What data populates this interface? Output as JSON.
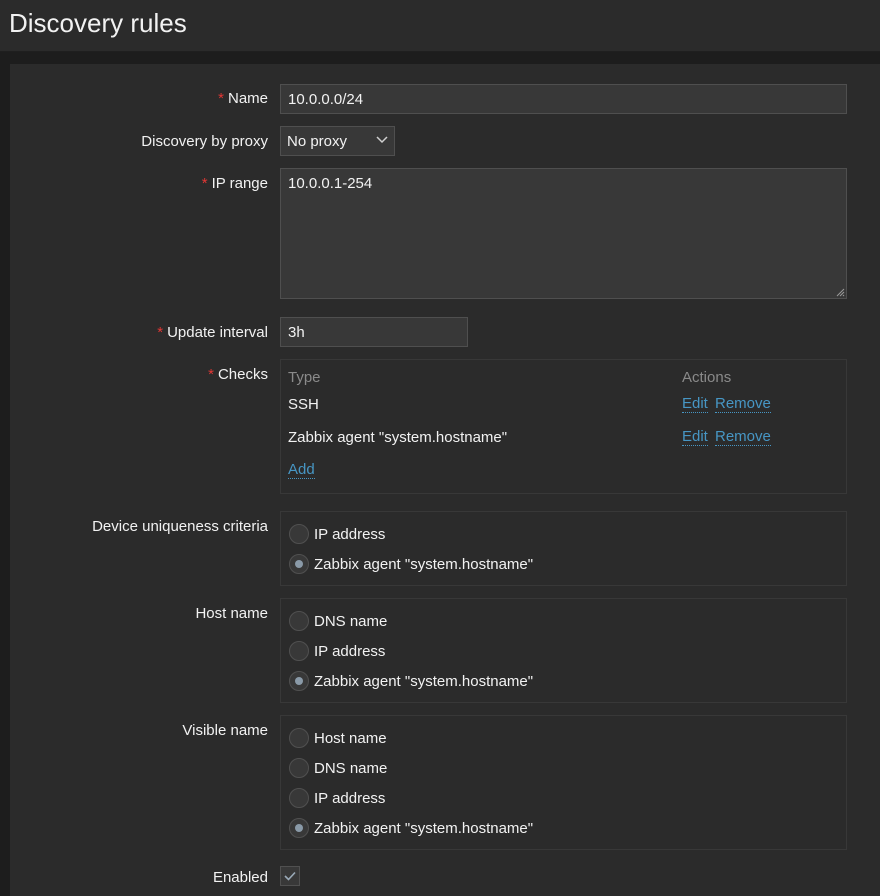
{
  "page": {
    "title": "Discovery rules"
  },
  "form": {
    "name": {
      "label": "Name",
      "value": "10.0.0.0/24"
    },
    "proxy": {
      "label": "Discovery by proxy",
      "value": "No proxy"
    },
    "ip_range": {
      "label": "IP range",
      "value": "10.0.0.1-254"
    },
    "update_interval": {
      "label": "Update interval",
      "value": "3h"
    },
    "checks": {
      "label": "Checks",
      "col_type": "Type",
      "col_actions": "Actions",
      "rows": [
        {
          "type": "SSH",
          "edit": "Edit",
          "remove": "Remove"
        },
        {
          "type": "Zabbix agent \"system.hostname\"",
          "edit": "Edit",
          "remove": "Remove"
        }
      ],
      "add": "Add"
    },
    "uniqueness": {
      "label": "Device uniqueness criteria",
      "options": [
        "IP address",
        "Zabbix agent \"system.hostname\""
      ],
      "selected": "Zabbix agent \"system.hostname\""
    },
    "host_name": {
      "label": "Host name",
      "options": [
        "DNS name",
        "IP address",
        "Zabbix agent \"system.hostname\""
      ],
      "selected": "Zabbix agent \"system.hostname\""
    },
    "visible_name": {
      "label": "Visible name",
      "options": [
        "Host name",
        "DNS name",
        "IP address",
        "Zabbix agent \"system.hostname\""
      ],
      "selected": "Zabbix agent \"system.hostname\""
    },
    "enabled": {
      "label": "Enabled",
      "checked": true
    }
  },
  "icons": {
    "proxy_dropdown": "chevron-down-icon",
    "resize": "resize-grip-icon",
    "enabled_check": "checkmark-icon"
  },
  "colors": {
    "background": "#2b2b2b",
    "required_asterisk": "#e33734",
    "link": "#4796c4",
    "input_bg": "#383838"
  }
}
